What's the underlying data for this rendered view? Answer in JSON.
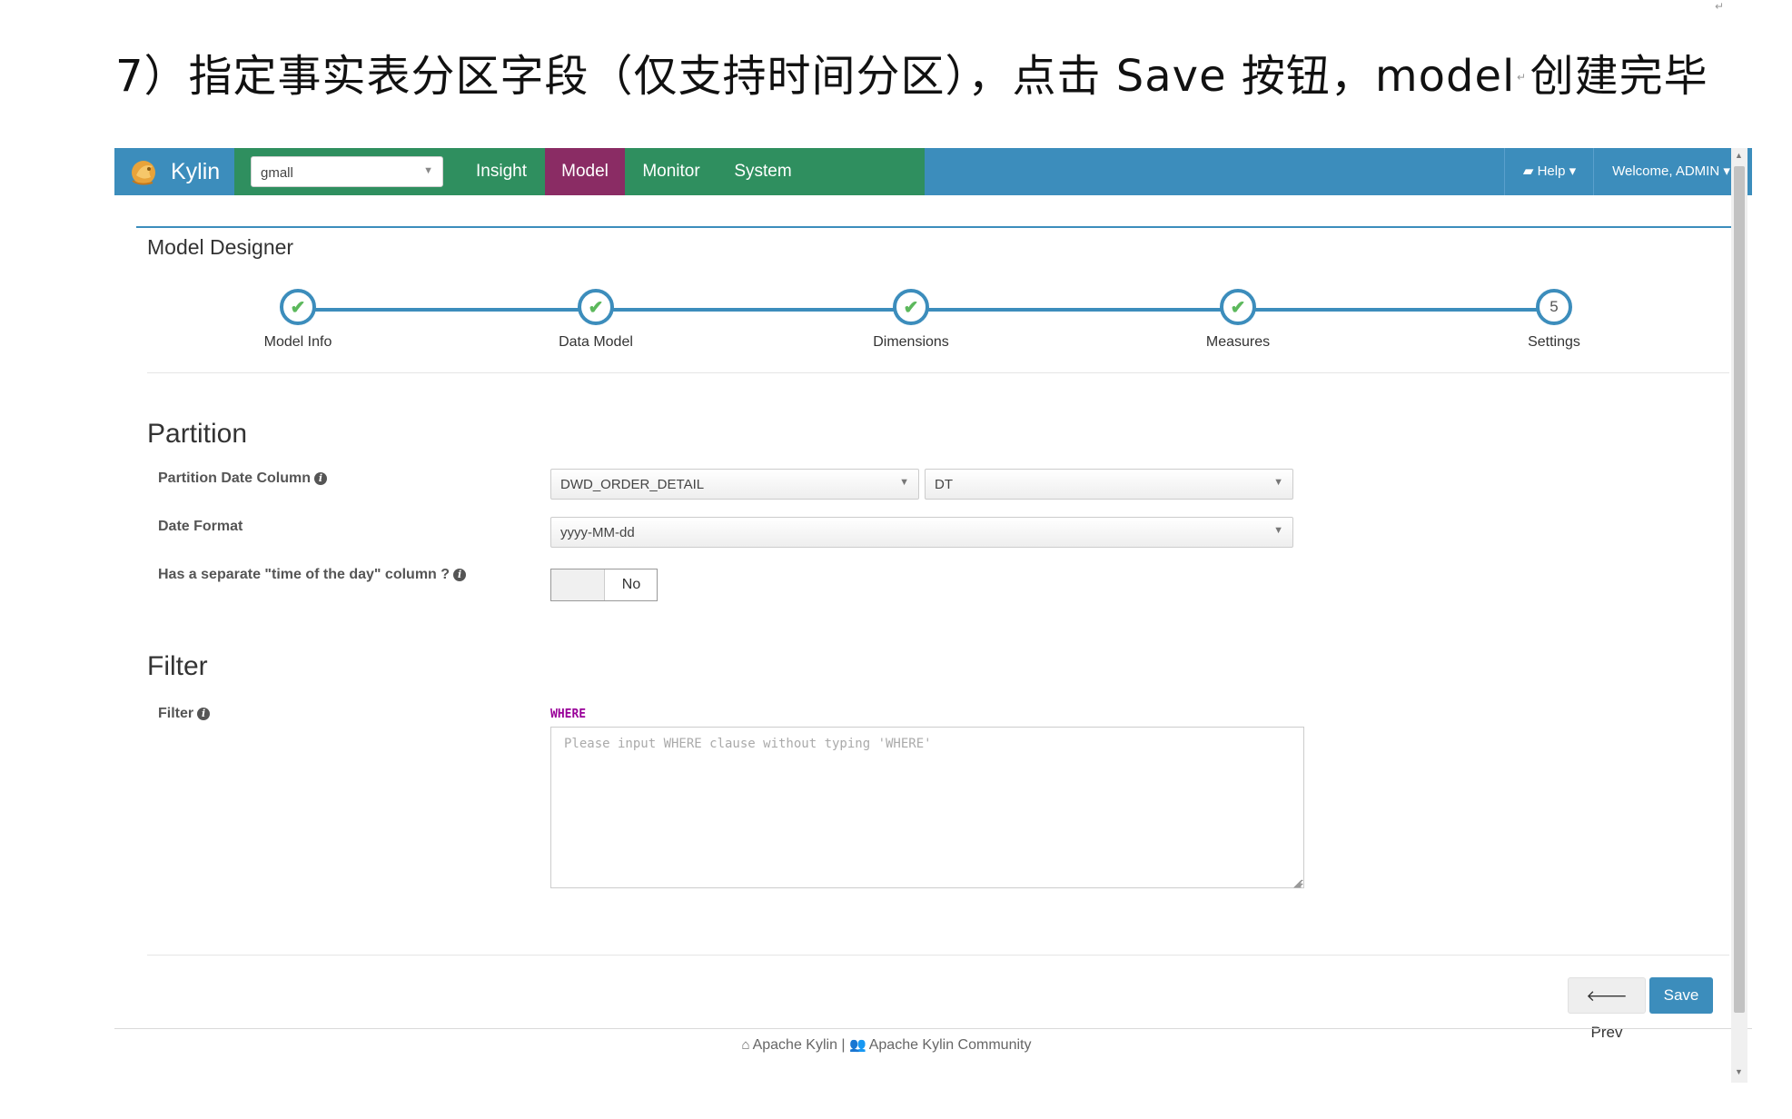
{
  "document": {
    "heading": "7）指定事实表分区字段（仅支持时间分区），点击 Save 按钮，model 创建完毕",
    "return_mark": "↵"
  },
  "navbar": {
    "brand": "Kylin",
    "project": {
      "selected": "gmall"
    },
    "items": [
      {
        "label": "Insight"
      },
      {
        "label": "Model"
      },
      {
        "label": "Monitor"
      },
      {
        "label": "System"
      }
    ],
    "active": "Model",
    "help_label": "Help",
    "user_label": "Welcome, ADMIN",
    "colors": {
      "bar": "#3c8dbc",
      "tabs": "#2f8f5f",
      "active_tab": "#8a2c64"
    }
  },
  "page": {
    "title": "Model Designer"
  },
  "wizard": {
    "steps": [
      {
        "label": "Model Info",
        "state": "done"
      },
      {
        "label": "Data Model",
        "state": "done"
      },
      {
        "label": "Dimensions",
        "state": "done"
      },
      {
        "label": "Measures",
        "state": "done"
      },
      {
        "label": "Settings",
        "state": "current",
        "number": "5"
      }
    ]
  },
  "partition": {
    "title": "Partition",
    "date_column_label": "Partition Date Column",
    "table_value": "DWD_ORDER_DETAIL",
    "column_value": "DT",
    "date_format_label": "Date Format",
    "date_format_value": "yyyy-MM-dd",
    "time_of_day_label": "Has a separate \"time of the day\" column ?",
    "time_of_day_value": "No"
  },
  "filter": {
    "title": "Filter",
    "label": "Filter",
    "keyword": "WHERE",
    "placeholder": "Please input WHERE clause without typing 'WHERE'",
    "value": ""
  },
  "actions": {
    "prev_label": "Prev",
    "save_label": "Save"
  },
  "footer": {
    "link1": "Apache Kylin",
    "separator": "|",
    "link2": "Apache Kylin Community"
  }
}
